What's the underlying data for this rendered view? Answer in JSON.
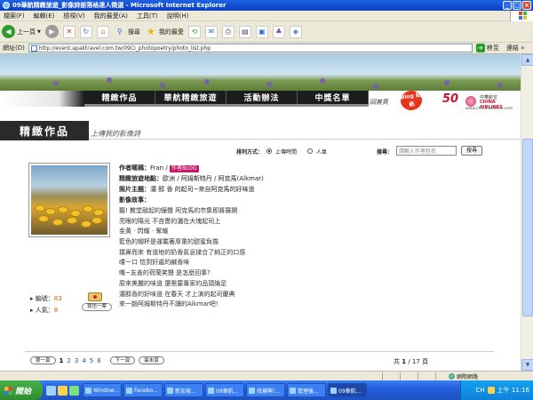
{
  "window": {
    "title": "09華航精緻旅遊_影像詩部落格達人徵選 - Microsoft Internet Explorer",
    "min": "_",
    "max": "□",
    "close": "×"
  },
  "menu": [
    "檔案(F)",
    "編輯(E)",
    "檢視(V)",
    "我的最愛(A)",
    "工具(T)",
    "說明(H)"
  ],
  "toolbar": {
    "back": "上一頁",
    "search": "搜尋",
    "favorites": "我的最愛"
  },
  "address": {
    "label": "網址(D)",
    "url": "http://event.apaktravel.com.tw/09CI_photopoetry/photo_list.php",
    "go": "移至",
    "links": "連結 »"
  },
  "site": {
    "nav": [
      "精緻作品",
      "華航精緻旅遊",
      "活動辦法",
      "中獎名單"
    ],
    "home": "回首頁",
    "blog_badge": "Blog 貼紙",
    "logo": {
      "num": "50",
      "cn": "中華航空",
      "en": "CHINA AIRLINES",
      "url": "www.china-airlines.com"
    },
    "section_title": "精緻作品",
    "section_sub": "上傳我的影像詩"
  },
  "sort": {
    "label": "排列方式：",
    "options": [
      "上傳時間",
      "人氣"
    ],
    "selected": 0
  },
  "search": {
    "label": "搜尋：",
    "placeholder": "請輸入作者姓名",
    "button": "搜尋"
  },
  "entry": {
    "author_label": "作者暱稱：",
    "author": "Fran",
    "author_tag": "作者BLOG",
    "dest_label": "精緻旅遊地點：",
    "dest": "歐洲 / 阿姆斯特丹 / 阿克馬(Alkmar)",
    "theme_label": "照片主題：",
    "theme": "濃 醇 香 的起司~來自阿克馬的好味道",
    "story_label": "影像故事：",
    "story": [
      "聽! 教堂敲起的鐘聲 阿克馬的市集即將展開",
      "亮眼的陽光 不吝嗇的灑在大塊起司上",
      "金黃 ‧ 閃耀 ‧ 奪耀",
      "藍色的帽杯是運載著厚重的甜蜜負擔",
      "撲鼻而來 有道地的奶香氣息揉合了純正的口感",
      "嚐一口 恰到好處的鹹香味",
      "嘴~友善的荷蘭笑聲 是怎麼回事?",
      "原來美麗的味道 還需要專家的品頭論足",
      "濃醇香的好味道 在春天 才上演的起司慶典",
      "來一趟阿姆斯特丹不讀的Alkmar吧!"
    ],
    "edition_label": "編號：",
    "edition": "83",
    "popularity_label": "人氣：",
    "popularity": "8",
    "vote_button": "我也一票"
  },
  "pager": {
    "prev_page": "第一頁",
    "pages": [
      "1",
      "2",
      "3",
      "4",
      "5",
      "6"
    ],
    "current": 0,
    "next": "下一頁",
    "last": "最末頁",
    "total_prefix": "共",
    "current_page": "1",
    "total_pages": "17",
    "total_suffix": "頁"
  },
  "status": {
    "zone": "網際網路"
  },
  "taskbar": {
    "start": "開始",
    "tasks": [
      "Window...",
      "Facebo...",
      "新加坡...",
      "09華航...",
      "找補啊!...",
      "管理後...",
      "09華航..."
    ],
    "active_task": 6,
    "tray_time": "上午 11:16",
    "tray_lang": "CH"
  }
}
